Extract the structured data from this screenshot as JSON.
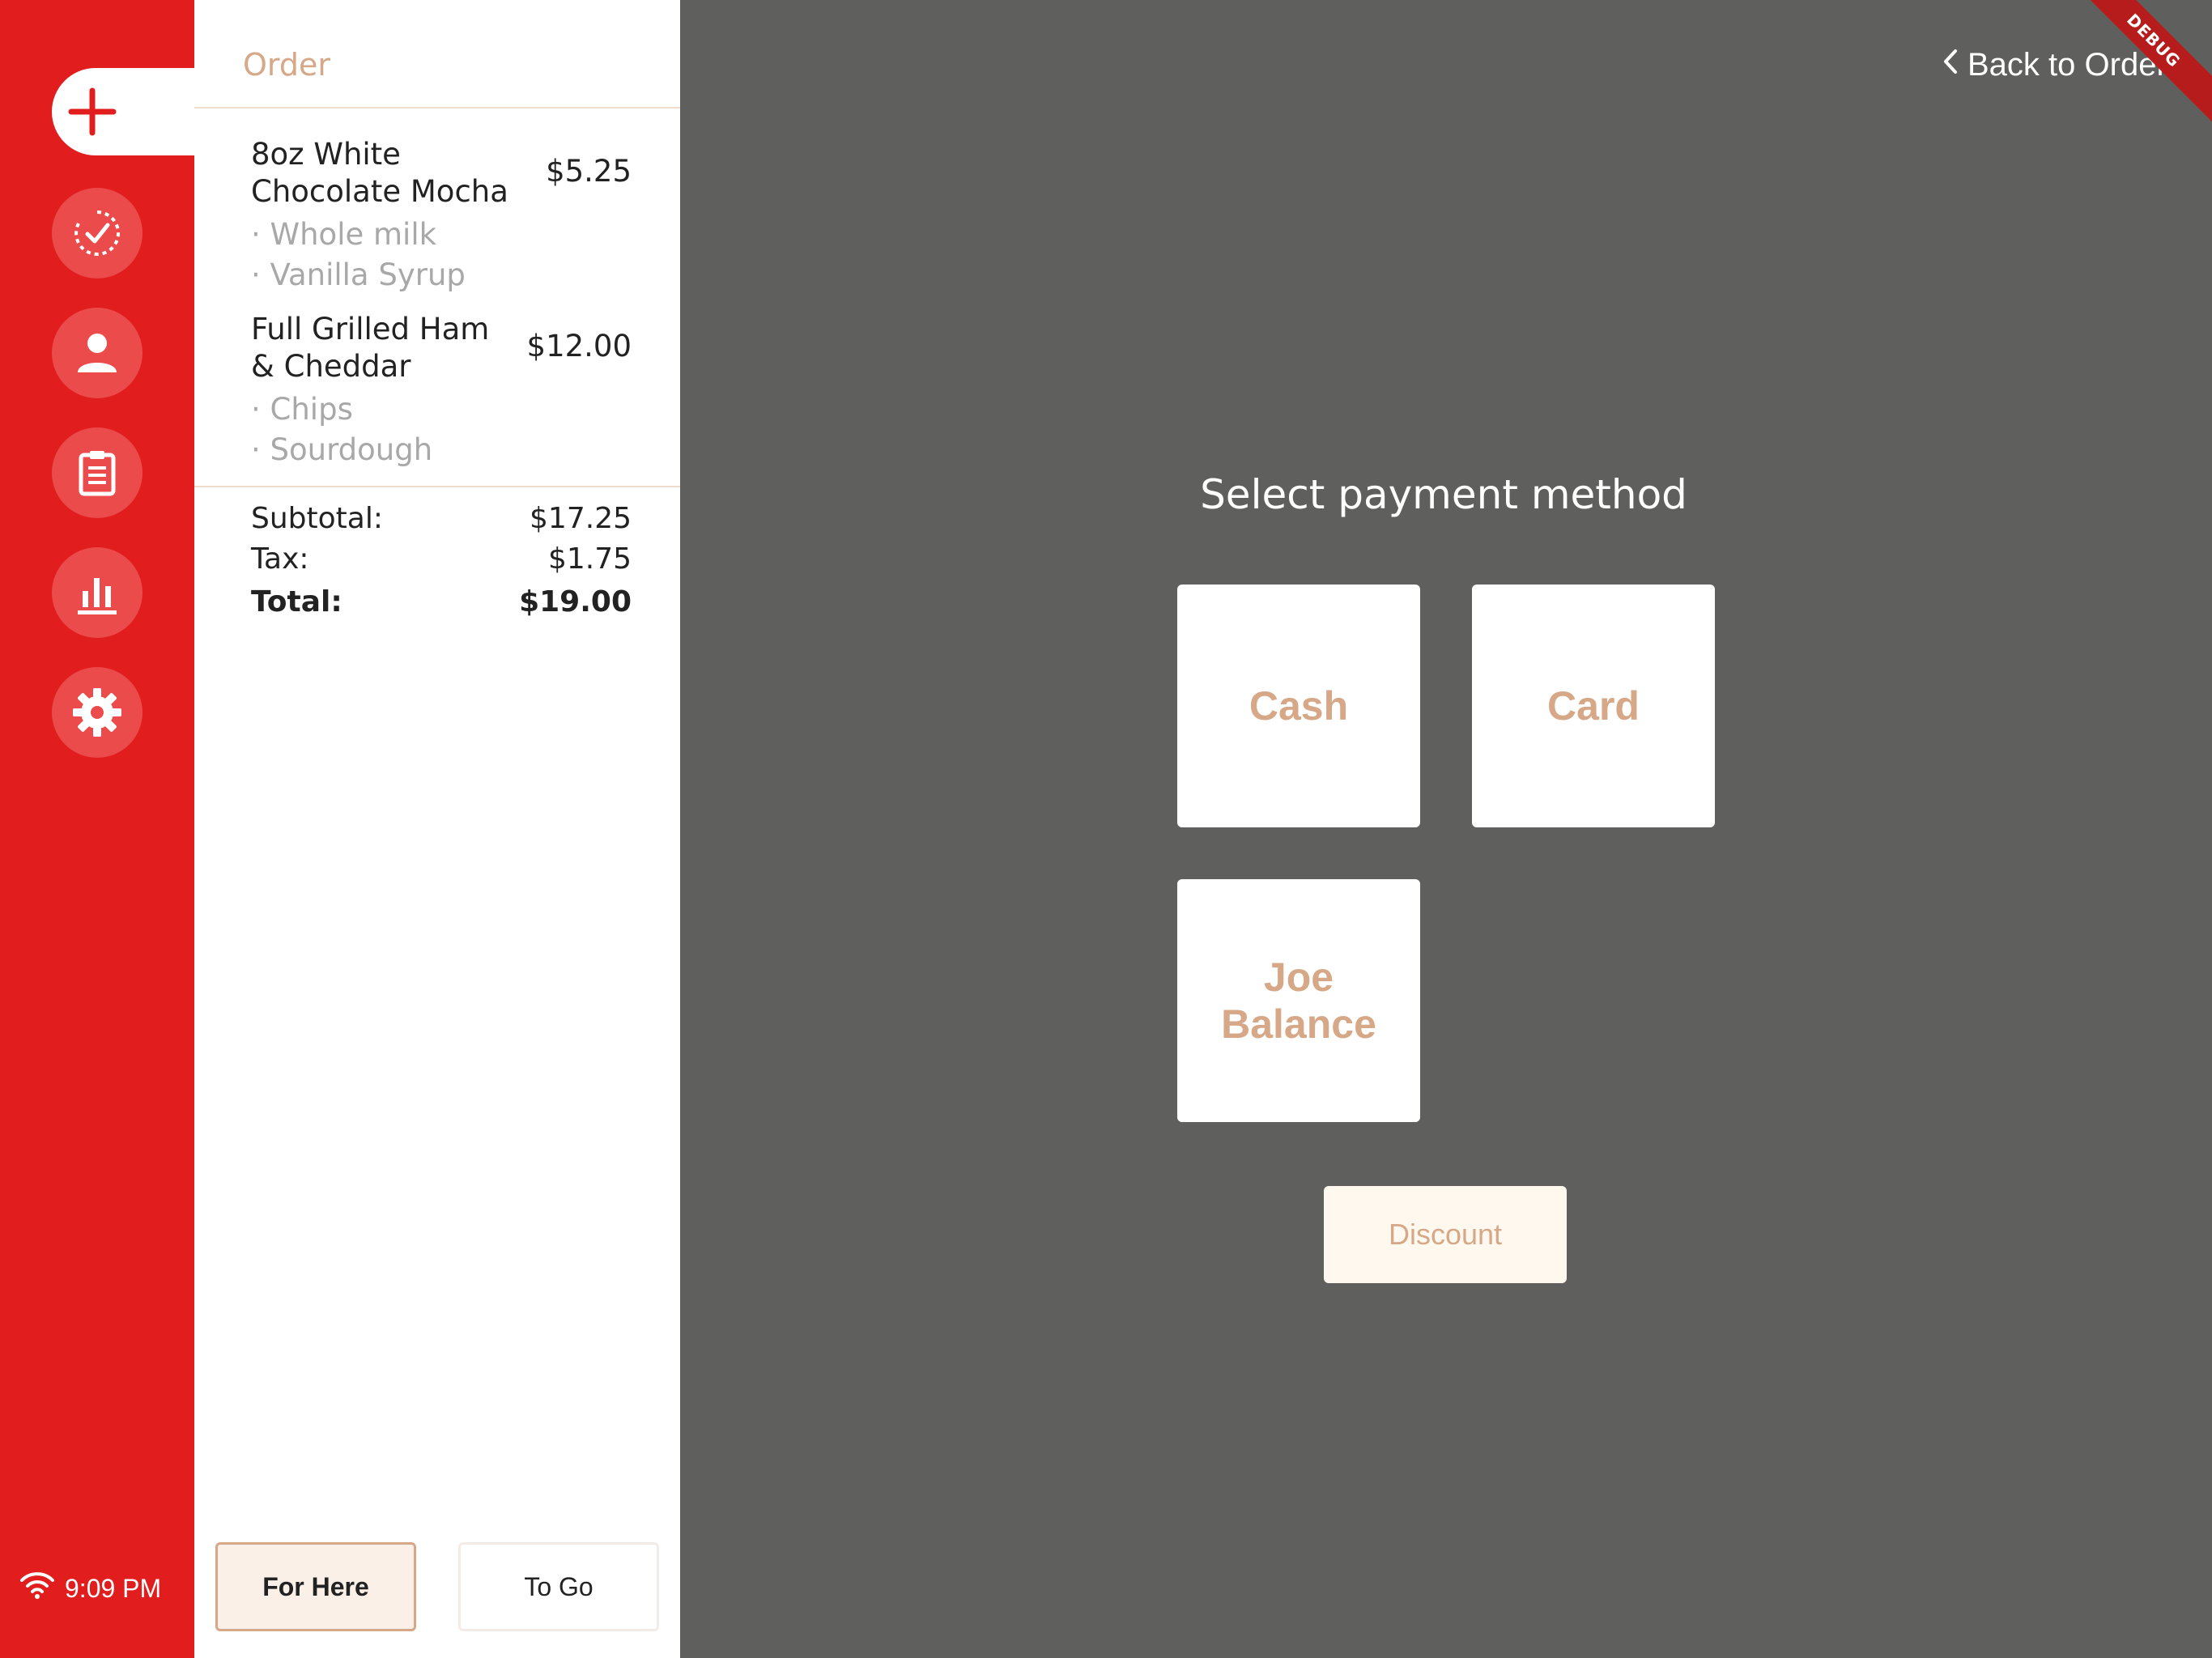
{
  "sidebar": {
    "items": [
      {
        "name": "new-order",
        "icon": "plus-icon"
      },
      {
        "name": "completed-orders",
        "icon": "check-circle-icon"
      },
      {
        "name": "customers",
        "icon": "person-icon"
      },
      {
        "name": "order-list",
        "icon": "clipboard-icon"
      },
      {
        "name": "reports",
        "icon": "bar-chart-icon"
      },
      {
        "name": "settings",
        "icon": "gear-icon"
      }
    ],
    "status": {
      "time": "9:09 PM",
      "wifi_icon": "wifi-icon"
    }
  },
  "order": {
    "title": "Order",
    "items": [
      {
        "name": " 8oz White Chocolate Mocha",
        "price": "$5.25",
        "modifiers": [
          "· Whole milk",
          "· Vanilla Syrup"
        ]
      },
      {
        "name": " Full Grilled Ham & Cheddar",
        "price": "$12.00",
        "modifiers": [
          "· Chips",
          "· Sourdough"
        ]
      }
    ],
    "subtotal_label": "Subtotal:",
    "subtotal": "$17.25",
    "tax_label": "Tax:",
    "tax": "$1.75",
    "total_label": "Total:",
    "total": "$19.00",
    "dine_options": {
      "for_here": "For Here",
      "to_go": "To Go",
      "selected": "For Here"
    }
  },
  "payment": {
    "back_label": "Back to Order",
    "title": "Select payment method",
    "methods": [
      "Cash",
      "Card",
      "Joe\nBalance"
    ],
    "discount_label": "Discount"
  },
  "debug_banner": "DEBUG",
  "colors": {
    "sidebar": "#e11d1d",
    "accent": "#d6a887",
    "main_bg": "#5f5f5d",
    "debug": "#b71c1c"
  }
}
